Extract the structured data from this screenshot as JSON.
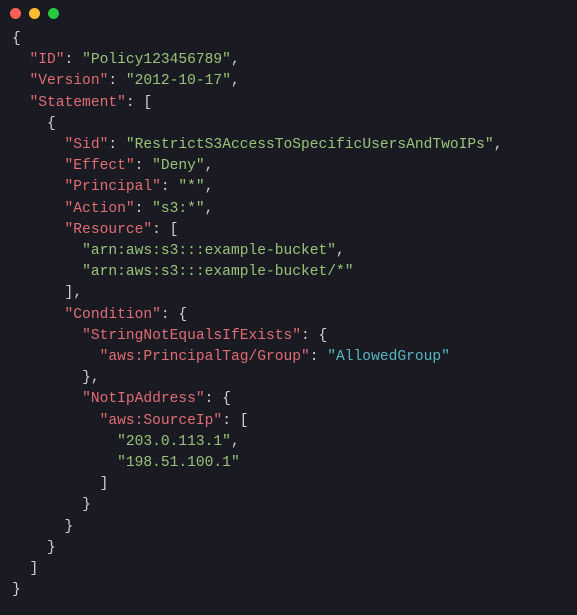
{
  "traffic_lights": {
    "close": "#ff5f57",
    "min": "#febc2e",
    "max": "#28c840"
  },
  "policy": {
    "ID": "Policy123456789",
    "Version": "2012-10-17",
    "Statement": [
      {
        "Sid": "RestrictS3AccessToSpecificUsersAndTwoIPs",
        "Effect": "Deny",
        "Principal": "*",
        "Action": "s3:*",
        "Resource": [
          "arn:aws:s3:::example-bucket",
          "arn:aws:s3:::example-bucket/*"
        ],
        "Condition": {
          "StringNotEqualsIfExists": {
            "aws:PrincipalTag/Group": "AllowedGroup"
          },
          "NotIpAddress": {
            "aws:SourceIp": [
              "203.0.113.1",
              "198.51.100.1"
            ]
          }
        }
      }
    ]
  }
}
